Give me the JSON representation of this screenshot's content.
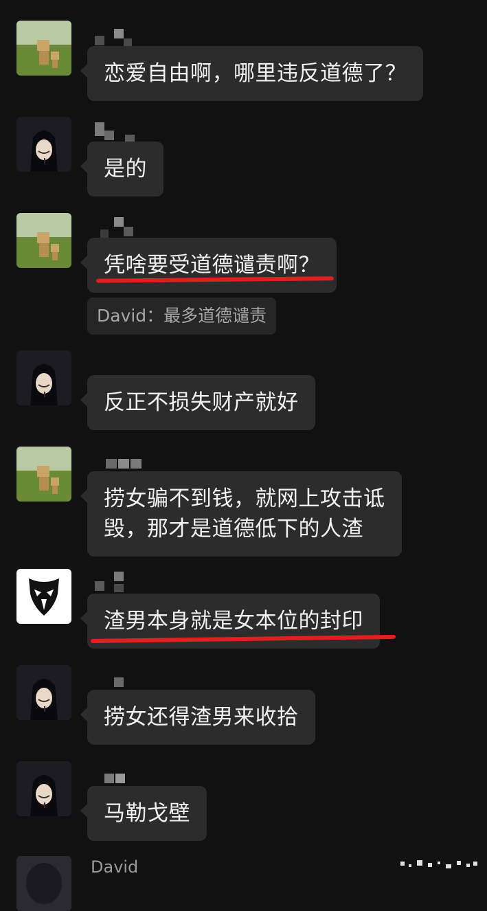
{
  "messages": [
    {
      "avatar": "figure-avatar",
      "text": "恋爱自由啊，哪里违反道德了？"
    },
    {
      "avatar": "mask-avatar",
      "text": "是的"
    },
    {
      "avatar": "figure-avatar",
      "text": "凭啥要受道德谴责啊？",
      "underlined": true
    },
    {
      "avatar": "mask-avatar",
      "text": "反正不损失财产就好"
    },
    {
      "avatar": "figure-avatar",
      "text": "捞女骗不到钱，就网上攻击诋\n毁，那才是道德低下的人渣"
    },
    {
      "avatar": "tribal-mask-avatar",
      "text": "渣男本身就是女本位的封印",
      "underlined": true
    },
    {
      "avatar": "mask-avatar",
      "text": "捞女还得渣男来收拾"
    },
    {
      "avatar": "mask-avatar",
      "text": "马勒戈壁"
    }
  ],
  "quote": {
    "text": "David：最多道德谴责"
  },
  "last_sender": {
    "name": "David"
  },
  "colors": {
    "background": "#111111",
    "bubble": "#2c2c2c",
    "bubble_text": "#f1f1f1",
    "underline": "#e02020"
  }
}
